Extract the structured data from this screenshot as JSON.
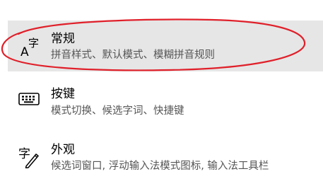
{
  "settings_list": {
    "items": [
      {
        "title": "常规",
        "description": "拼音样式、默认模式、模糊拼音规则",
        "icon": "font-A-zi-icon",
        "icon_glyph_latin": "A",
        "icon_glyph_cjk": "字",
        "selected": true
      },
      {
        "title": "按键",
        "description": "模式切换、候选字词、快捷键",
        "icon": "keyboard-icon",
        "selected": false
      },
      {
        "title": "外观",
        "description": "候选词窗口, 浮动输入法模式图标, 输入法工具栏",
        "icon": "zi-pen-icon",
        "icon_glyph_cjk": "字",
        "selected": false
      }
    ]
  },
  "colors": {
    "selected_background": "#e6e6e6",
    "annotation_ellipse": "#e0202a",
    "description_text": "#555555"
  }
}
